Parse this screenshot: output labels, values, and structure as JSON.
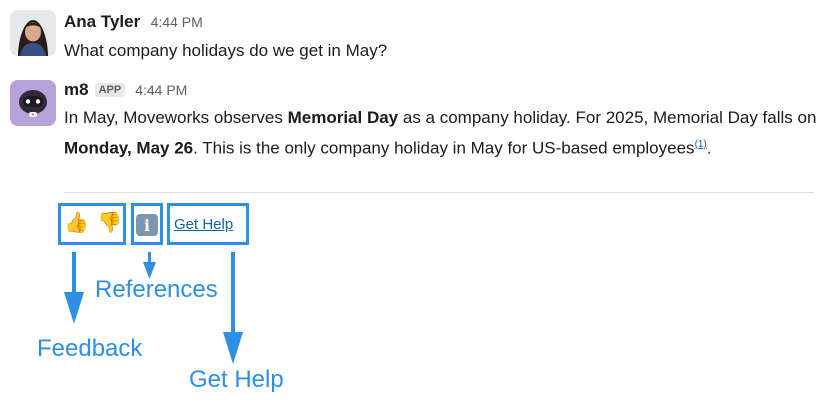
{
  "messages": [
    {
      "sender": "Ana Tyler",
      "time": "4:44 PM",
      "text": "What company holidays do we get in May?"
    },
    {
      "sender": "m8",
      "badge": "APP",
      "time": "4:44 PM",
      "text_parts": {
        "p1": "In May, Moveworks observes ",
        "b1": "Memorial Day",
        "p2": " as a company holiday. For 2025, Memorial Day falls on ",
        "b2": "Monday, May 26",
        "p3": ". This is the only company holiday in May for US-based employees",
        "citation": "(1)",
        "p4": "."
      }
    }
  ],
  "actions": {
    "thumbs_up": "👍",
    "thumbs_down": "👎",
    "info": "i",
    "get_help": "Get Help"
  },
  "annotations": {
    "feedback": "Feedback",
    "references": "References",
    "get_help": "Get Help"
  },
  "colors": {
    "accent": "#2d8fe8",
    "link": "#1264a3"
  }
}
